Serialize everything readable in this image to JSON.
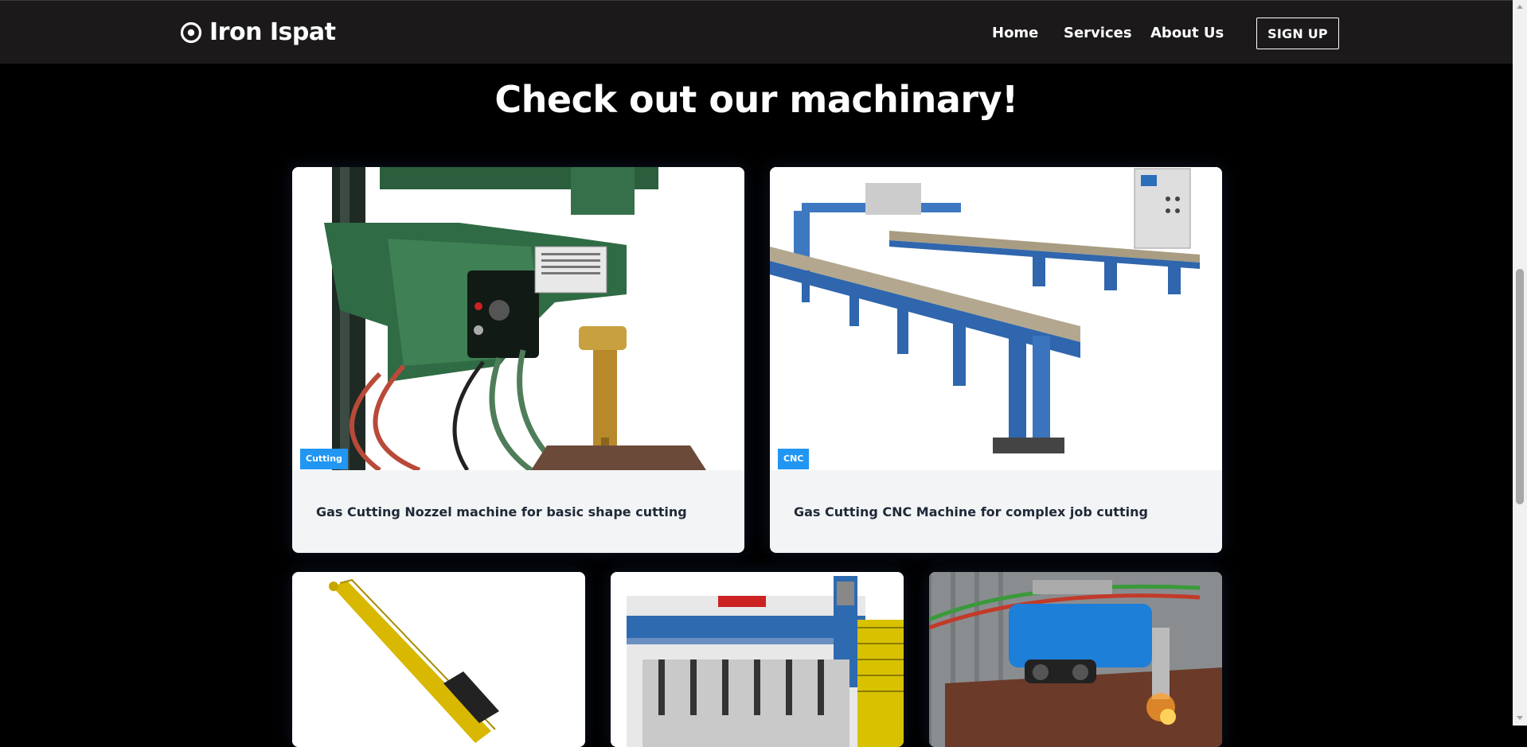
{
  "navbar": {
    "brand": "Iron Ispat",
    "links": [
      {
        "label": "Home"
      },
      {
        "label": "Services"
      },
      {
        "label": "About Us"
      }
    ],
    "signup_label": "SIGN UP"
  },
  "main": {
    "heading": "Check out our machinary!",
    "cards": [
      {
        "tag": "Cutting",
        "title": "Gas Cutting Nozzel machine for basic shape cutting"
      },
      {
        "tag": "CNC",
        "title": "Gas Cutting CNC Machine for complex job cutting"
      },
      {
        "tag": "",
        "title": ""
      },
      {
        "tag": "",
        "title": ""
      },
      {
        "tag": "",
        "title": ""
      }
    ]
  },
  "colors": {
    "page_bg": "#000000",
    "navbar_bg": "#1b1919",
    "badge": "#2196f3",
    "card_bg": "#f3f4f6"
  },
  "icons": {
    "brand": "target-icon"
  }
}
